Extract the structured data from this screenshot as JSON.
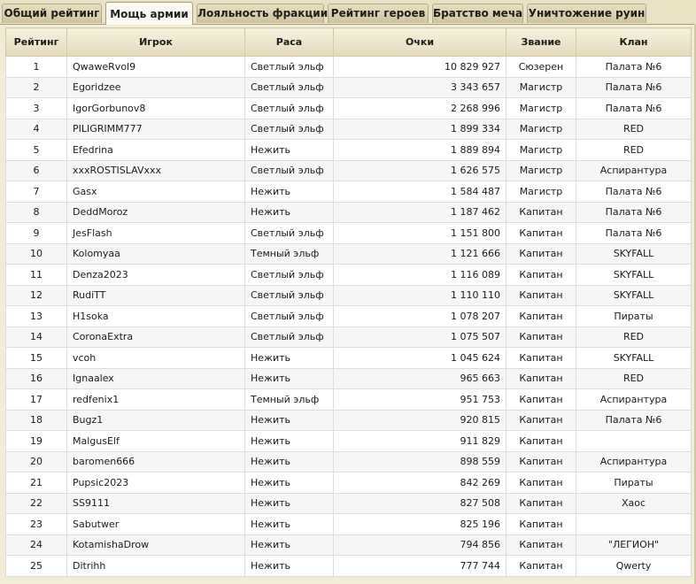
{
  "tabs": [
    {
      "label": "Общий рейтинг",
      "active": false
    },
    {
      "label": "Мощь армии",
      "active": true
    },
    {
      "label": "Лояльность фракции",
      "active": false
    },
    {
      "label": "Рейтинг героев",
      "active": false
    },
    {
      "label": "Братство меча",
      "active": false
    },
    {
      "label": "Уничтожение руин",
      "active": false
    }
  ],
  "table": {
    "columns": [
      "Рейтинг",
      "Игрок",
      "Раса",
      "Очки",
      "Звание",
      "Клан"
    ],
    "rows": [
      {
        "rank": "1",
        "player": "QwaweRvol9",
        "race": "Светлый эльф",
        "points": "10 829 927",
        "title": "Сюзерен",
        "clan": "Палата №6"
      },
      {
        "rank": "2",
        "player": "Egoridzee",
        "race": "Светлый эльф",
        "points": "3 343 657",
        "title": "Магистр",
        "clan": "Палата №6"
      },
      {
        "rank": "3",
        "player": "IgorGorbunov8",
        "race": "Светлый эльф",
        "points": "2 268 996",
        "title": "Магистр",
        "clan": "Палата №6"
      },
      {
        "rank": "4",
        "player": "PILIGRIMM777",
        "race": "Светлый эльф",
        "points": "1 899 334",
        "title": "Магистр",
        "clan": "RED"
      },
      {
        "rank": "5",
        "player": "Efedrina",
        "race": "Нежить",
        "points": "1 889 894",
        "title": "Магистр",
        "clan": "RED"
      },
      {
        "rank": "6",
        "player": "xxxROSTISLAVxxx",
        "race": "Светлый эльф",
        "points": "1 626 575",
        "title": "Магистр",
        "clan": "Аспирантура"
      },
      {
        "rank": "7",
        "player": "Gasx",
        "race": "Нежить",
        "points": "1 584 487",
        "title": "Магистр",
        "clan": "Палата №6"
      },
      {
        "rank": "8",
        "player": "DeddMoroz",
        "race": "Нежить",
        "points": "1 187 462",
        "title": "Капитан",
        "clan": "Палата №6"
      },
      {
        "rank": "9",
        "player": "JesFlash",
        "race": "Светлый эльф",
        "points": "1 151 800",
        "title": "Капитан",
        "clan": "Палата №6"
      },
      {
        "rank": "10",
        "player": "Kolomyaa",
        "race": "Темный эльф",
        "points": "1 121 666",
        "title": "Капитан",
        "clan": "SKYFALL"
      },
      {
        "rank": "11",
        "player": "Denza2023",
        "race": "Светлый эльф",
        "points": "1 116 089",
        "title": "Капитан",
        "clan": "SKYFALL"
      },
      {
        "rank": "12",
        "player": "RudiTT",
        "race": "Светлый эльф",
        "points": "1 110 110",
        "title": "Капитан",
        "clan": "SKYFALL"
      },
      {
        "rank": "13",
        "player": "H1soka",
        "race": "Светлый эльф",
        "points": "1 078 207",
        "title": "Капитан",
        "clan": "Пираты"
      },
      {
        "rank": "14",
        "player": "CoronaExtra",
        "race": "Светлый эльф",
        "points": "1 075 507",
        "title": "Капитан",
        "clan": "RED"
      },
      {
        "rank": "15",
        "player": "vcoh",
        "race": "Нежить",
        "points": "1 045 624",
        "title": "Капитан",
        "clan": "SKYFALL"
      },
      {
        "rank": "16",
        "player": "Ignaalex",
        "race": "Нежить",
        "points": "965 663",
        "title": "Капитан",
        "clan": "RED"
      },
      {
        "rank": "17",
        "player": "redfenix1",
        "race": "Темный эльф",
        "points": "951 753",
        "title": "Капитан",
        "clan": "Аспирантура"
      },
      {
        "rank": "18",
        "player": "Bugz1",
        "race": "Нежить",
        "points": "920 815",
        "title": "Капитан",
        "clan": "Палата №6"
      },
      {
        "rank": "19",
        "player": "MalgusElf",
        "race": "Нежить",
        "points": "911 829",
        "title": "Капитан",
        "clan": ""
      },
      {
        "rank": "20",
        "player": "baromen666",
        "race": "Нежить",
        "points": "898 559",
        "title": "Капитан",
        "clan": "Аспирантура"
      },
      {
        "rank": "21",
        "player": "Pupsic2023",
        "race": "Нежить",
        "points": "842 269",
        "title": "Капитан",
        "clan": "Пираты"
      },
      {
        "rank": "22",
        "player": "SS9111",
        "race": "Нежить",
        "points": "827 508",
        "title": "Капитан",
        "clan": "Хаос"
      },
      {
        "rank": "23",
        "player": "Sabutwer",
        "race": "Нежить",
        "points": "825 196",
        "title": "Капитан",
        "clan": ""
      },
      {
        "rank": "24",
        "player": "KotamishaDrow",
        "race": "Нежить",
        "points": "794 856",
        "title": "Капитан",
        "clan": "\"ЛЕГИОН\""
      },
      {
        "rank": "25",
        "player": "Ditrihh",
        "race": "Нежить",
        "points": "777 744",
        "title": "Капитан",
        "clan": "Qwerty"
      }
    ]
  }
}
